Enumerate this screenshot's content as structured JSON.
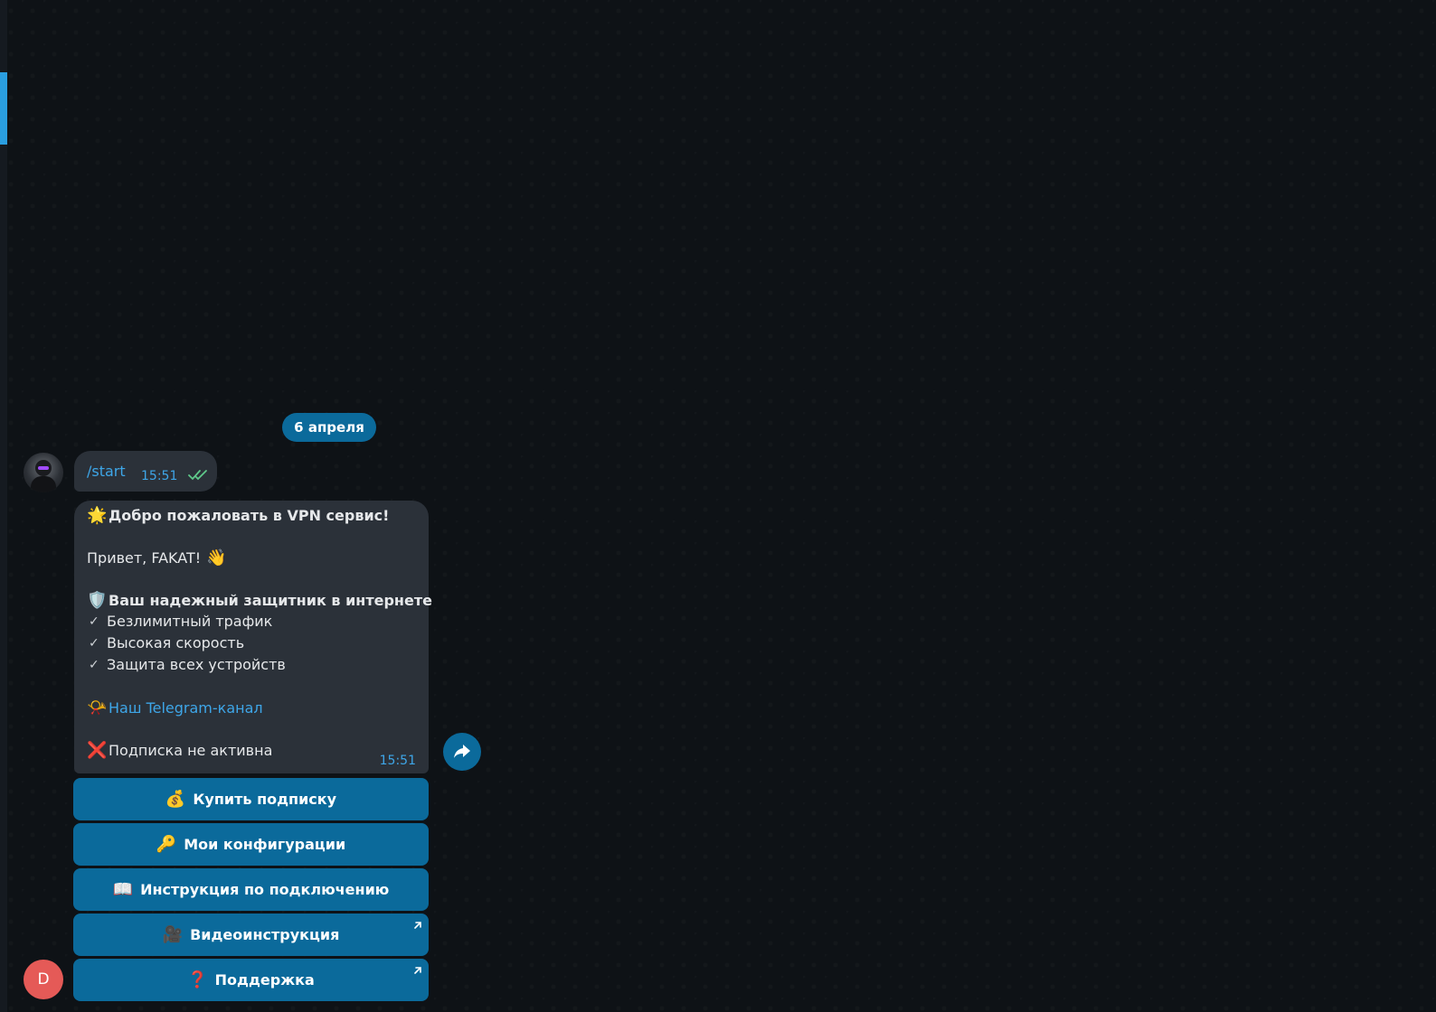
{
  "chat": {
    "date_separator": "6 апреля",
    "user_avatar_letter": "D",
    "accent_color": "#0b6a9b",
    "link_color": "#3ea6e8"
  },
  "messages": {
    "start": {
      "text": "/start",
      "time": "15:51",
      "status_icon": "double-check-icon"
    },
    "welcome": {
      "time": "15:51",
      "lines": {
        "title_emoji": "🌟",
        "title": "Добро пожаловать в VPN сервис!",
        "greeting": "Привет, FAKAT!",
        "greeting_emoji": "👋",
        "defender_emoji": "🛡️",
        "defender": "Ваш надежный защитник в интернете",
        "check_mark": "✓",
        "feature_1": "Безлимитный трафик",
        "feature_2": "Высокая скорость",
        "feature_3": "Защита всех устройств",
        "channel_emoji": "📯",
        "channel_link": "Наш Telegram-канал",
        "status_emoji": "❌",
        "status": "Подписка не активна"
      }
    }
  },
  "keyboard": {
    "buy": {
      "emoji": "💰",
      "label": "Купить подписку"
    },
    "configs": {
      "emoji": "🔑",
      "label": "Мои конфигурации"
    },
    "instructions": {
      "emoji": "📖",
      "label": "Инструкция по подключению"
    },
    "video": {
      "emoji": "🎥",
      "label": "Видеоинструкция",
      "icon": "external-arrow-icon"
    },
    "support": {
      "emoji": "❓",
      "label": "Поддержка",
      "icon": "external-arrow-icon"
    }
  }
}
